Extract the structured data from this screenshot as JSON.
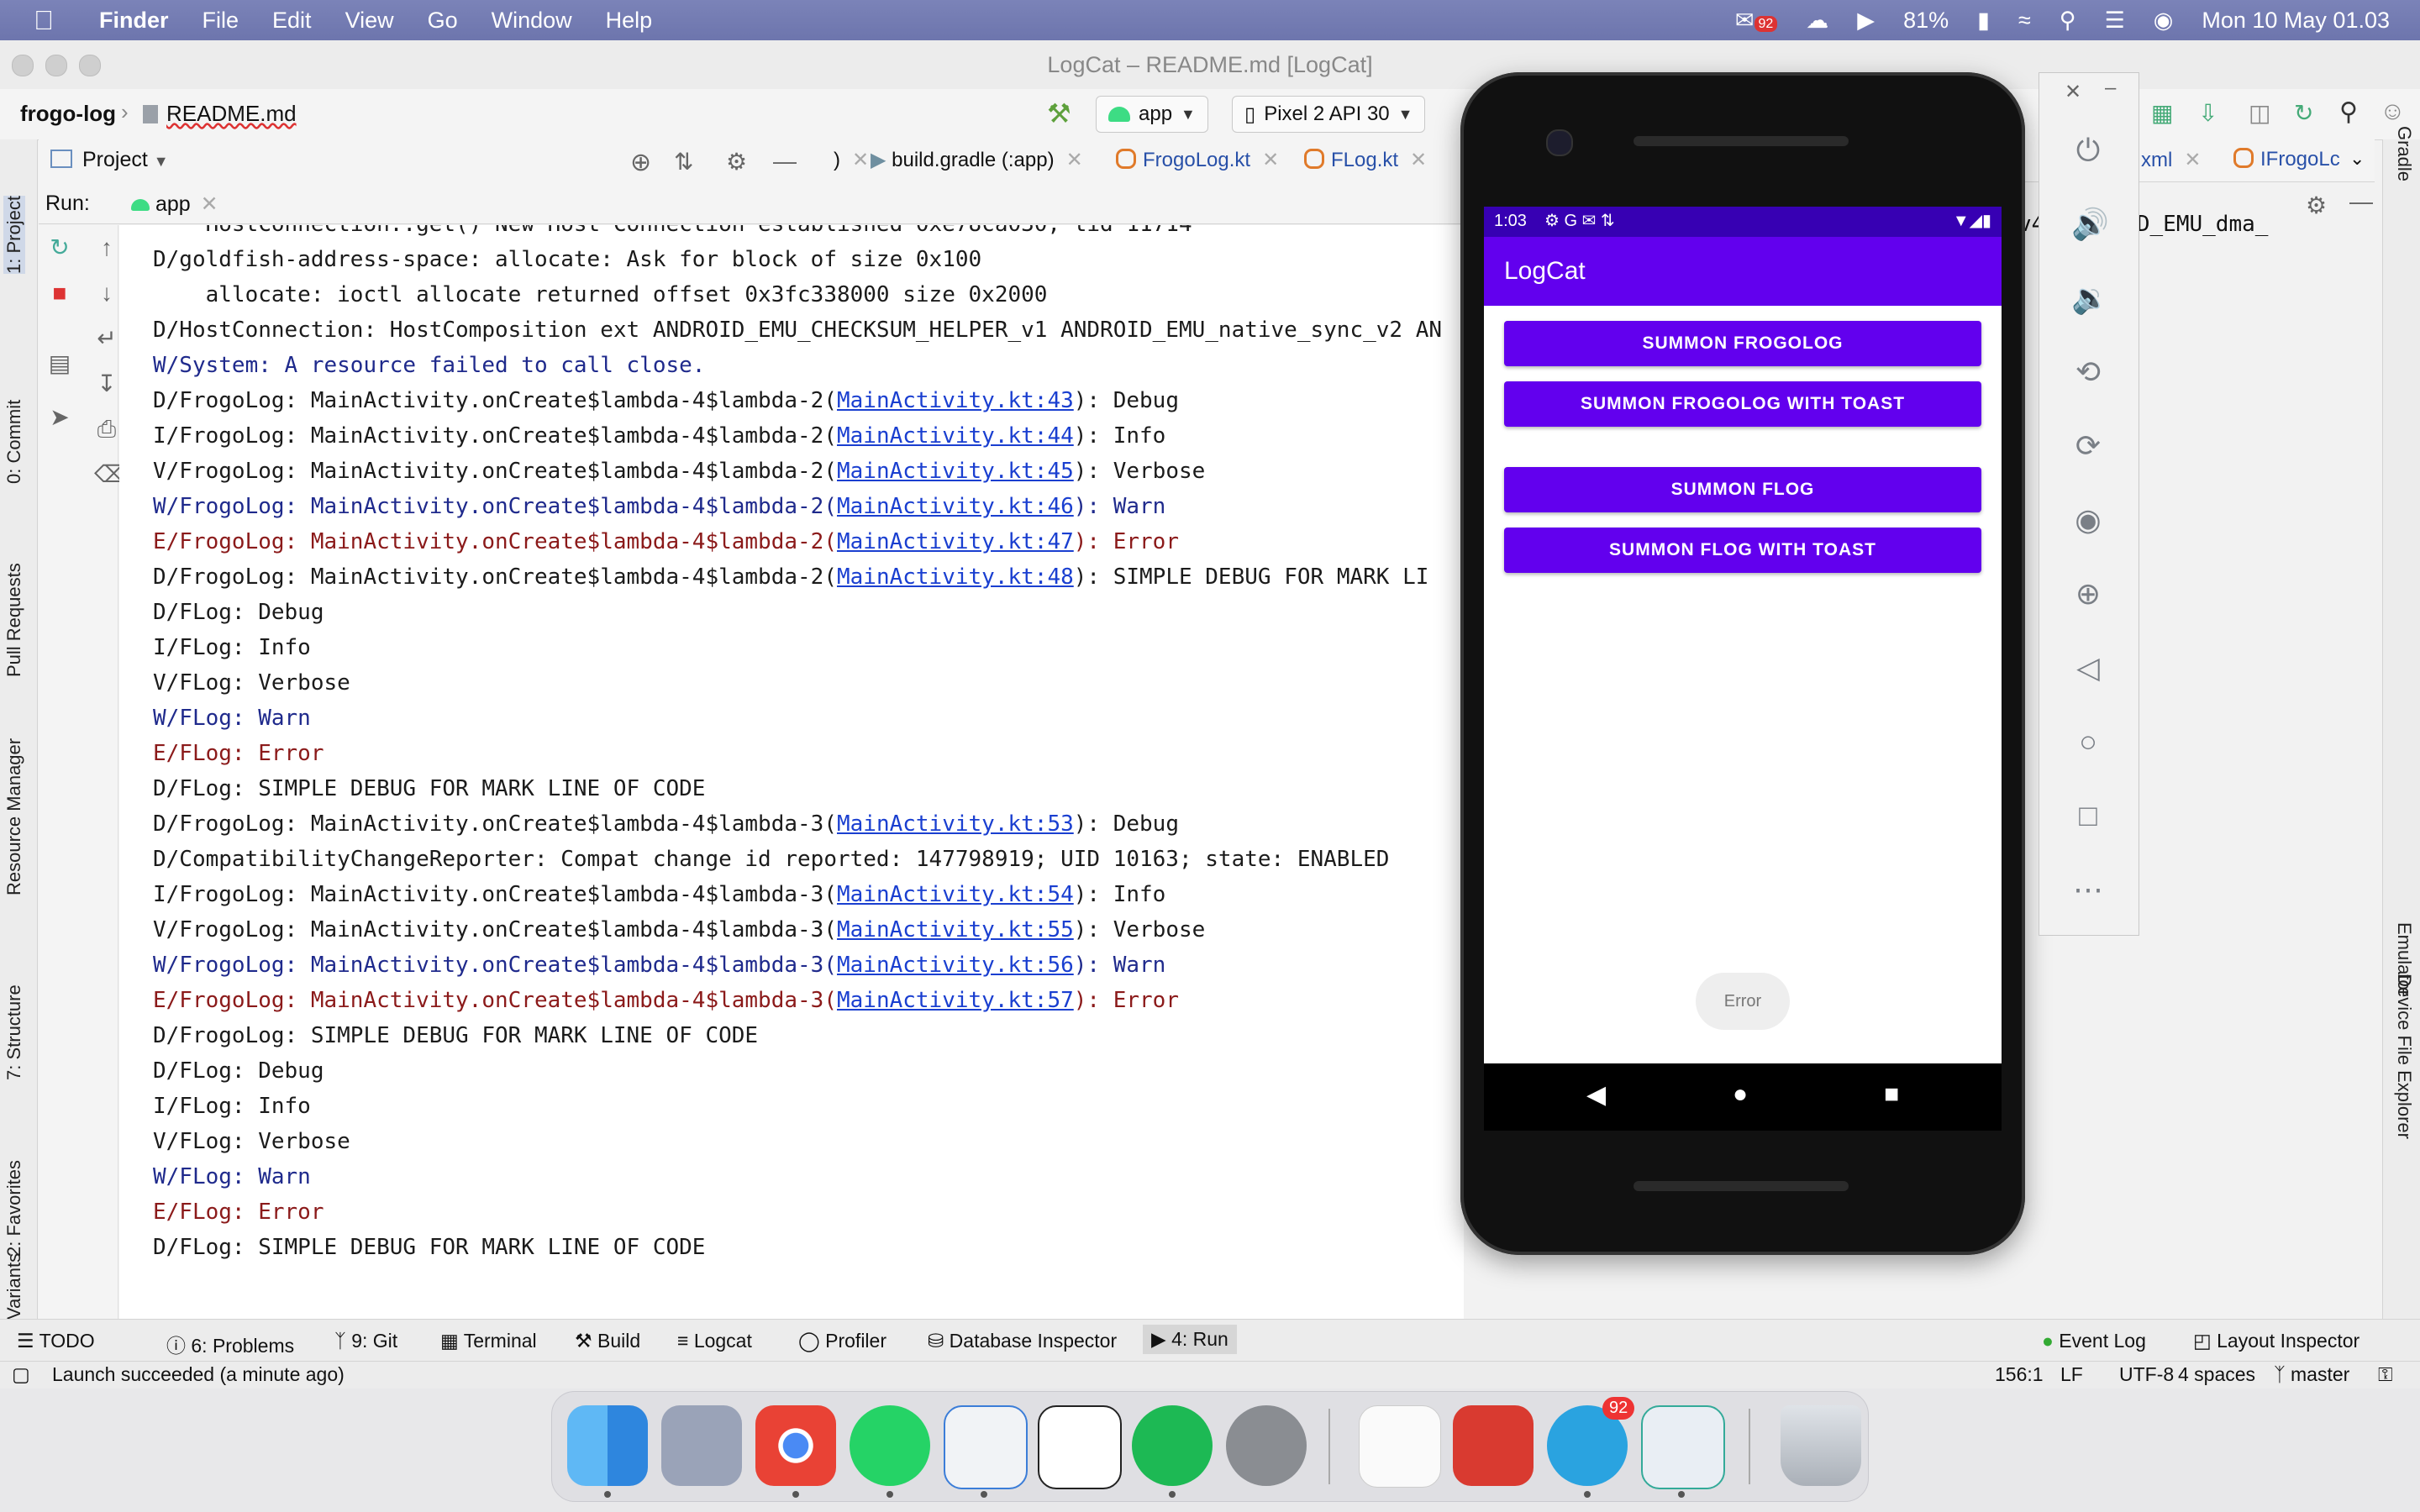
{
  "menubar": {
    "app": "Finder",
    "items": [
      "File",
      "Edit",
      "View",
      "Go",
      "Window",
      "Help"
    ],
    "mail_badge": "92",
    "battery": "81%",
    "clock": "Mon 10 May  01.03"
  },
  "ide": {
    "title": "LogCat – README.md [LogCat]",
    "breadcrumb": [
      "frogo-log",
      "README.md"
    ],
    "run_config": "app",
    "device": "Pixel 2 API 30",
    "project_label": "Project",
    "tabs": [
      ")",
      "build.gradle (:app)",
      "FrogoLog.kt",
      "FLog.kt",
      "n.xml",
      "IFrogoLc"
    ],
    "run_label": "Run:",
    "run_tab": "app",
    "left_tools": [
      "1: Project",
      "0: Commit",
      "Pull Requests",
      "Resource Manager",
      "7: Structure",
      "2: Favorites",
      "Build Variants"
    ],
    "right_tools": [
      "Gradle",
      "Emulator",
      "Device File Explorer"
    ],
    "console_lines": [
      {
        "lvl": "D",
        "pre": "    HostConnection::get() New Host Connection established 0xe78ca030, tid 11714",
        "link": "",
        "post": ""
      },
      {
        "lvl": "D",
        "pre": "D/goldfish-address-space: allocate: Ask for block of size 0x100",
        "link": "",
        "post": ""
      },
      {
        "lvl": "D",
        "pre": "    allocate: ioctl allocate returned offset 0x3fc338000 size 0x2000",
        "link": "",
        "post": ""
      },
      {
        "lvl": "D",
        "pre": "D/HostConnection: HostComposition ext ANDROID_EMU_CHECKSUM_HELPER_v1 ANDROID_EMU_native_sync_v2 AN",
        "link": "",
        "post": ""
      },
      {
        "lvl": "W",
        "pre": "W/System: A resource failed to call close.",
        "link": "",
        "post": ""
      },
      {
        "lvl": "D",
        "pre": "D/FrogoLog: MainActivity.onCreate$lambda-4$lambda-2(",
        "link": "MainActivity.kt:43",
        "post": "): Debug"
      },
      {
        "lvl": "I",
        "pre": "I/FrogoLog: MainActivity.onCreate$lambda-4$lambda-2(",
        "link": "MainActivity.kt:44",
        "post": "): Info"
      },
      {
        "lvl": "V",
        "pre": "V/FrogoLog: MainActivity.onCreate$lambda-4$lambda-2(",
        "link": "MainActivity.kt:45",
        "post": "): Verbose"
      },
      {
        "lvl": "W",
        "pre": "W/FrogoLog: MainActivity.onCreate$lambda-4$lambda-2(",
        "link": "MainActivity.kt:46",
        "post": "): Warn"
      },
      {
        "lvl": "E",
        "pre": "E/FrogoLog: MainActivity.onCreate$lambda-4$lambda-2(",
        "link": "MainActivity.kt:47",
        "post": "): Error"
      },
      {
        "lvl": "D",
        "pre": "D/FrogoLog: MainActivity.onCreate$lambda-4$lambda-2(",
        "link": "MainActivity.kt:48",
        "post": "): SIMPLE DEBUG FOR MARK LI"
      },
      {
        "lvl": "D",
        "pre": "D/FLog: Debug",
        "link": "",
        "post": ""
      },
      {
        "lvl": "I",
        "pre": "I/FLog: Info",
        "link": "",
        "post": ""
      },
      {
        "lvl": "V",
        "pre": "V/FLog: Verbose",
        "link": "",
        "post": ""
      },
      {
        "lvl": "W",
        "pre": "W/FLog: Warn",
        "link": "",
        "post": ""
      },
      {
        "lvl": "E",
        "pre": "E/FLog: Error",
        "link": "",
        "post": ""
      },
      {
        "lvl": "D",
        "pre": "D/FLog: SIMPLE DEBUG FOR MARK LINE OF CODE",
        "link": "",
        "post": ""
      },
      {
        "lvl": "D",
        "pre": "D/FrogoLog: MainActivity.onCreate$lambda-4$lambda-3(",
        "link": "MainActivity.kt:53",
        "post": "): Debug"
      },
      {
        "lvl": "D",
        "pre": "D/CompatibilityChangeReporter: Compat change id reported: 147798919; UID 10163; state: ENABLED",
        "link": "",
        "post": ""
      },
      {
        "lvl": "I",
        "pre": "I/FrogoLog: MainActivity.onCreate$lambda-4$lambda-3(",
        "link": "MainActivity.kt:54",
        "post": "): Info"
      },
      {
        "lvl": "V",
        "pre": "V/FrogoLog: MainActivity.onCreate$lambda-4$lambda-3(",
        "link": "MainActivity.kt:55",
        "post": "): Verbose"
      },
      {
        "lvl": "W",
        "pre": "W/FrogoLog: MainActivity.onCreate$lambda-4$lambda-3(",
        "link": "MainActivity.kt:56",
        "post": "): Warn"
      },
      {
        "lvl": "E",
        "pre": "E/FrogoLog: MainActivity.onCreate$lambda-4$lambda-3(",
        "link": "MainActivity.kt:57",
        "post": "): Error"
      },
      {
        "lvl": "D",
        "pre": "D/FrogoLog: SIMPLE DEBUG FOR MARK LINE OF CODE",
        "link": "",
        "post": ""
      },
      {
        "lvl": "D",
        "pre": "D/FLog: Debug",
        "link": "",
        "post": ""
      },
      {
        "lvl": "I",
        "pre": "I/FLog: Info",
        "link": "",
        "post": ""
      },
      {
        "lvl": "V",
        "pre": "V/FLog: Verbose",
        "link": "",
        "post": ""
      },
      {
        "lvl": "W",
        "pre": "W/FLog: Warn",
        "link": "",
        "post": ""
      },
      {
        "lvl": "E",
        "pre": "E/FLog: Error",
        "link": "",
        "post": ""
      },
      {
        "lvl": "D",
        "pre": "D/FLog: SIMPLE DEBUG FOR MARK LINE OF CODE",
        "link": "",
        "post": ""
      }
    ],
    "console_right_fragment": "v4 ANDROID_EMU_dma_",
    "bottom_tabs": [
      "TODO",
      "6: Problems",
      "9: Git",
      "Terminal",
      "Build",
      "Logcat",
      "Profiler",
      "Database Inspector",
      "4: Run"
    ],
    "bottom_right": [
      "Event Log",
      "Layout Inspector"
    ],
    "status_left": "Launch succeeded (a minute ago)",
    "status_right": [
      "156:1",
      "LF",
      "UTF-8",
      "4 spaces",
      "master"
    ]
  },
  "phone": {
    "time": "1:03",
    "app_title": "LogCat",
    "buttons": [
      "SUMMON FROGOLOG",
      "SUMMON FROGOLOG WITH TOAST",
      "SUMMON FLOG",
      "SUMMON FLOG WITH TOAST"
    ],
    "toast": "Error"
  },
  "colors": {
    "accent": "#6200ee",
    "status_bar": "#3700b3",
    "warn": "#1f2a8c",
    "error": "#8b1a1a",
    "link": "#1a3fd0"
  },
  "dock": {
    "apps": [
      "finder-icon",
      "launchpad-icon",
      "chrome-icon",
      "whatsapp-icon",
      "android-studio-icon",
      "unity-icon",
      "spotify-icon",
      "system-preferences-icon",
      "textedit-icon",
      "photo-booth-icon",
      "telegram-icon",
      "simulator-icon",
      "trash-icon"
    ],
    "telegram_badge": "92"
  }
}
